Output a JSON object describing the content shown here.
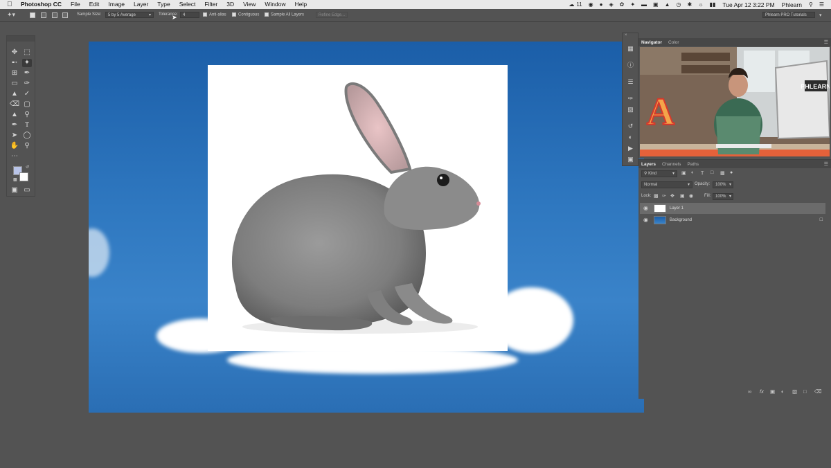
{
  "menubar": {
    "app_name": "Photoshop CC",
    "items": [
      "File",
      "Edit",
      "Image",
      "Layer",
      "Type",
      "Select",
      "Filter",
      "3D",
      "View",
      "Window",
      "Help"
    ],
    "clock": "Tue Apr 12  3:22 PM",
    "user": "Phlearn",
    "notification_count": "11"
  },
  "options_bar": {
    "sample_size_label": "Sample Size:",
    "sample_size_value": "5 by 5 Average",
    "tolerance_label": "Tolerance:",
    "tolerance_value": "4",
    "anti_alias_label": "Anti-alias",
    "contiguous_label": "Contiguous",
    "sample_all_layers_label": "Sample All Layers",
    "refine_edge_label": "Refine Edge...",
    "workspace": "Phlearn PRO Tutorials"
  },
  "navigator": {
    "tabs": [
      "Navigator",
      "Color"
    ],
    "preview_sign_letter": "A",
    "preview_monitor_text": "PHLEARN"
  },
  "layers": {
    "tabs": [
      "Layers",
      "Channels",
      "Paths"
    ],
    "filter_kind": "Kind",
    "blend_mode": "Normal",
    "opacity_label": "Opacity:",
    "opacity_value": "100%",
    "lock_label": "Lock:",
    "fill_label": "Fill:",
    "fill_value": "100%",
    "items": [
      {
        "name": "Layer 1"
      },
      {
        "name": "Background"
      }
    ]
  },
  "colors": {
    "sky": "#2f78c0",
    "panel": "#535353",
    "foreground_swatch": "#b9c4e8",
    "background_swatch": "#ffffff"
  }
}
